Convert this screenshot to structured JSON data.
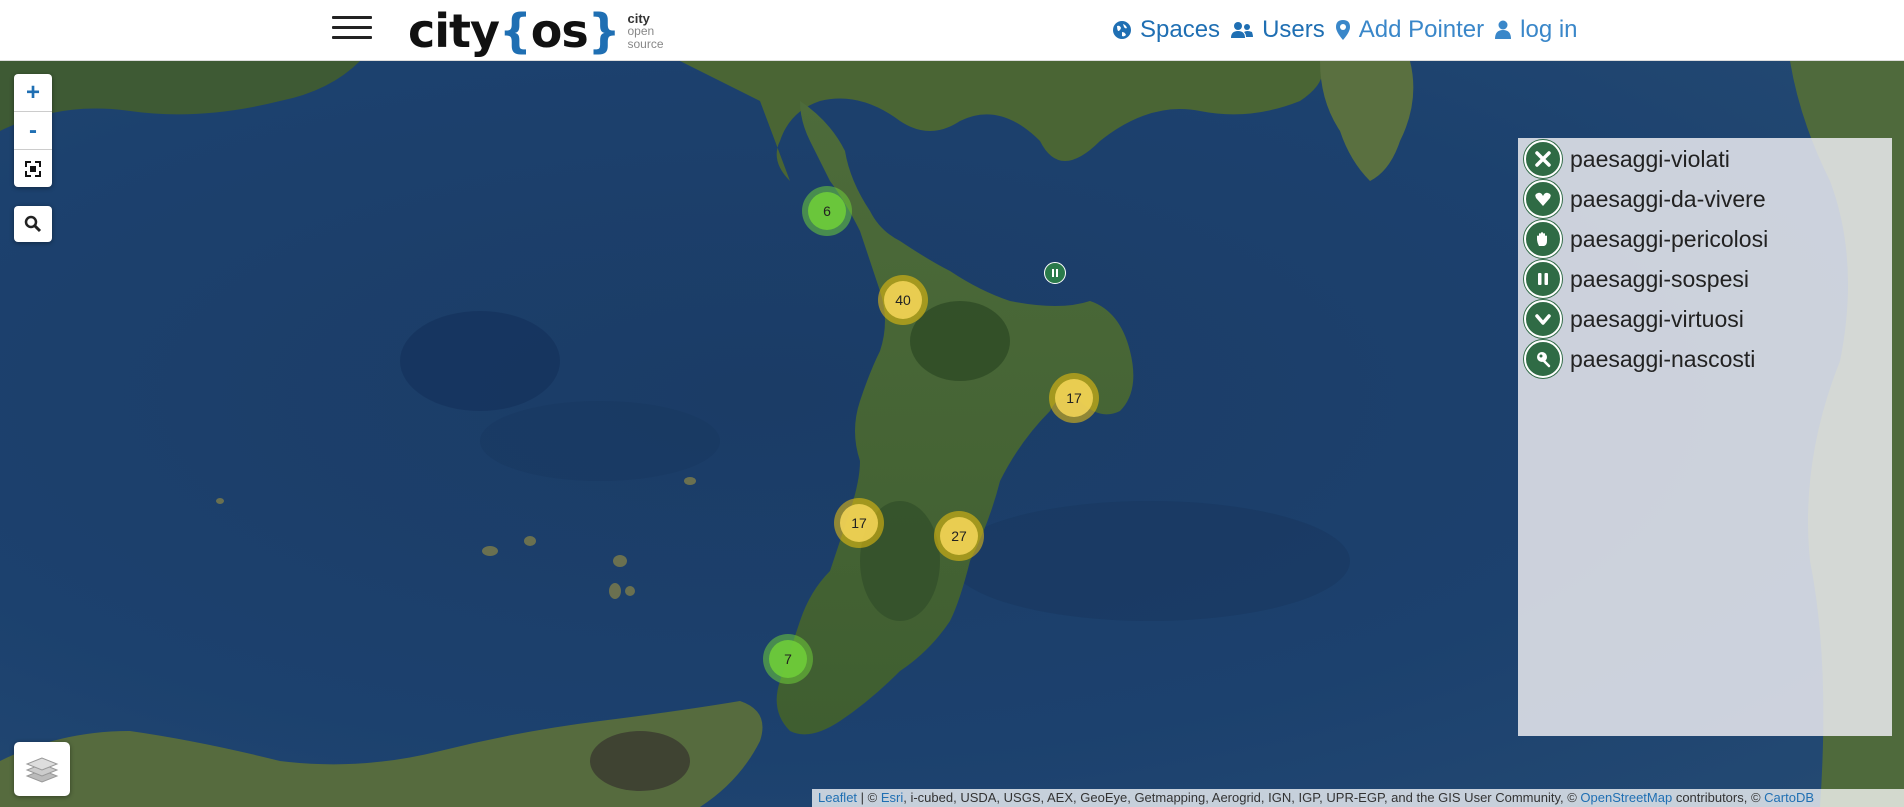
{
  "header": {
    "logo": {
      "word_city": "city",
      "brace_open": "{",
      "word_os": "os",
      "brace_close": "}",
      "sub1": "city",
      "sub2": "open",
      "sub3": "source"
    },
    "nav": [
      {
        "label": "Spaces",
        "icon": "globe-icon"
      },
      {
        "label": "Users",
        "icon": "users-icon"
      },
      {
        "label": "Add Pointer",
        "icon": "map-marker-icon"
      },
      {
        "label": "log in",
        "icon": "user-icon"
      }
    ]
  },
  "map_controls": {
    "zoom_in": "+",
    "zoom_out": "-",
    "fullscreen_icon": "fullscreen-icon",
    "search_icon": "search-icon",
    "layers_icon": "layers-icon"
  },
  "clusters": [
    {
      "count": "6",
      "color": "green"
    },
    {
      "count": "40",
      "color": "yellow"
    },
    {
      "count": "17",
      "color": "yellow"
    },
    {
      "count": "17",
      "color": "yellow"
    },
    {
      "count": "27",
      "color": "yellow"
    },
    {
      "count": "7",
      "color": "green"
    }
  ],
  "legend": {
    "items": [
      {
        "label": "paesaggi-violati",
        "icon": "x-icon"
      },
      {
        "label": "paesaggi-da-vivere",
        "icon": "heart-icon"
      },
      {
        "label": "paesaggi-pericolosi",
        "icon": "hand-icon"
      },
      {
        "label": "paesaggi-sospesi",
        "icon": "pause-icon"
      },
      {
        "label": "paesaggi-virtuosi",
        "icon": "check-icon"
      },
      {
        "label": "paesaggi-nascosti",
        "icon": "pin-icon"
      }
    ]
  },
  "attribution": {
    "leaflet": "Leaflet",
    "sep1": " | © ",
    "esri": "Esri",
    "text1": ", i-cubed, USDA, USGS, AEX, GeoEye, Getmapping, Aerogrid, IGN, IGP, UPR-EGP, and the GIS User Community, © ",
    "osm": "OpenStreetMap",
    "text2": " contributors, © ",
    "carto": "CartoDB"
  },
  "colors": {
    "brand_blue": "#1f6fb3",
    "sea": "#1d3e66",
    "cluster_green": "#6ecc39",
    "cluster_yellow": "#f1d357",
    "legend_icon_green": "#2f6b45"
  }
}
